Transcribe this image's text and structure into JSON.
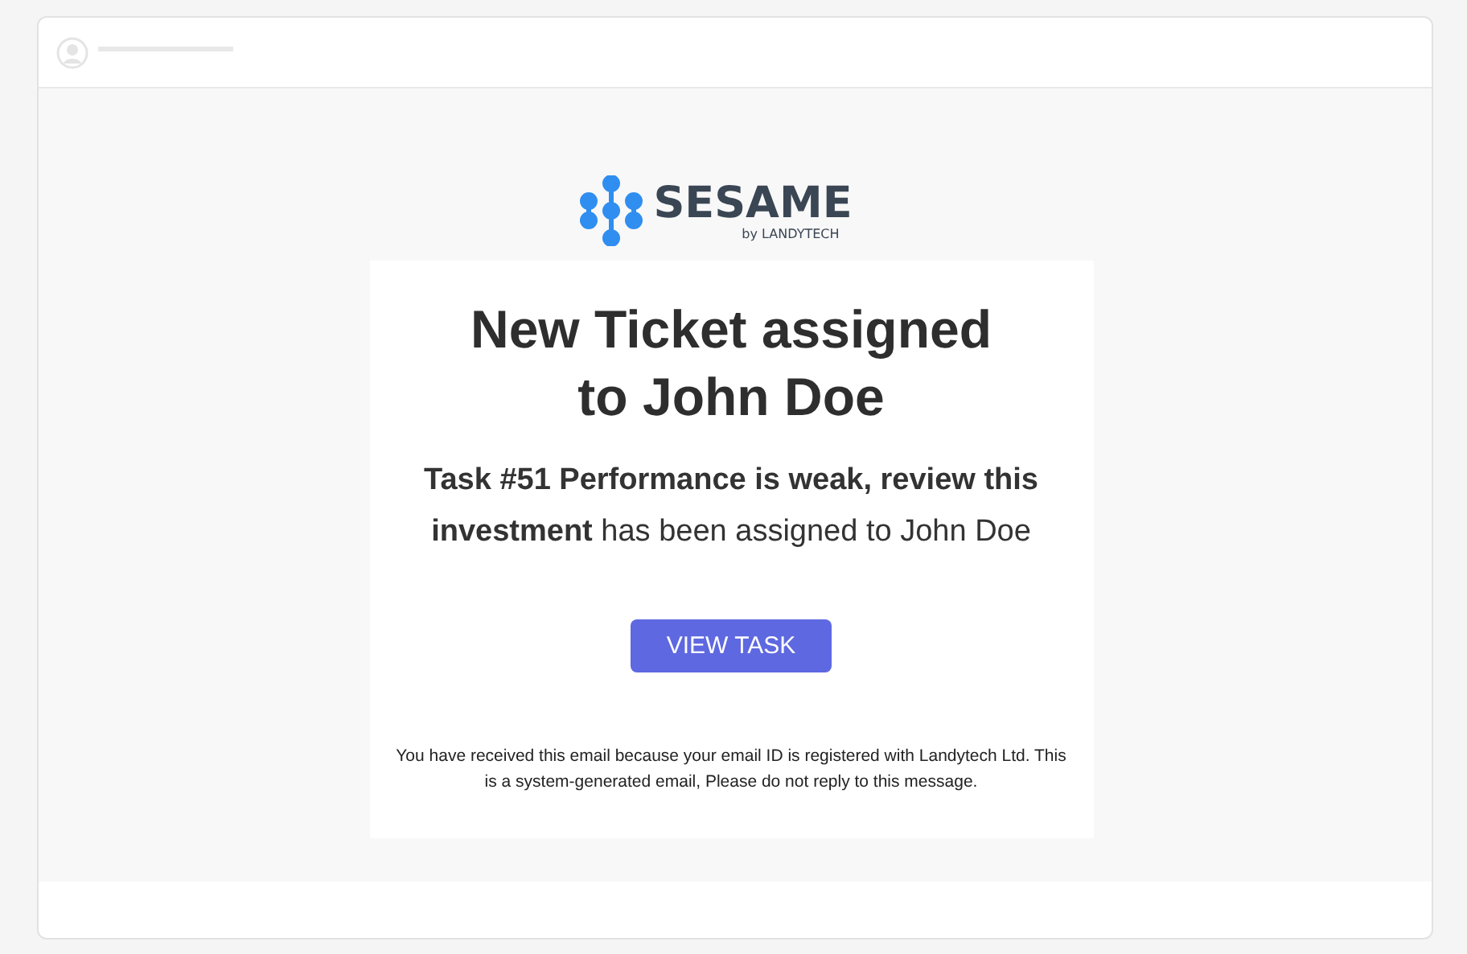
{
  "logo": {
    "name": "SESAME",
    "tagline": "by LANDYTECH"
  },
  "email": {
    "title": "New Ticket assigned to John Doe",
    "message": "**Task #51 Performance is weak, review this investment**  has been assigned to John Doe",
    "button": "VIEW TASK",
    "footer": "You have received this email because your email ID is registered with Landytech Ltd. This is a system-generated email, Please do not reply to this message."
  }
}
